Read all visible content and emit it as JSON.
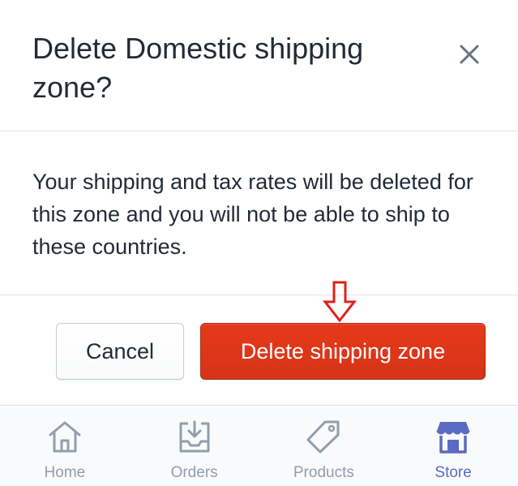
{
  "dialog": {
    "title": "Delete Domestic shipping zone?",
    "body": "Your shipping and tax rates will be deleted for this zone and you will not be able to ship to these countries.",
    "cancel_label": "Cancel",
    "confirm_label": "Delete shipping zone",
    "close_icon": "close-icon",
    "annotation_icon": "down-arrow-annotation-icon"
  },
  "tab_bar": {
    "tabs": [
      {
        "label": "Home",
        "icon": "home-icon",
        "active": false
      },
      {
        "label": "Orders",
        "icon": "orders-inbox-icon",
        "active": false
      },
      {
        "label": "Products",
        "icon": "tag-icon",
        "active": false
      },
      {
        "label": "Store",
        "icon": "store-icon",
        "active": true
      }
    ]
  },
  "colors": {
    "destructive": "#de3618",
    "text": "#212b36",
    "muted": "#919eab",
    "active_tab": "#5c6ac4",
    "annotation": "#e0201a"
  }
}
